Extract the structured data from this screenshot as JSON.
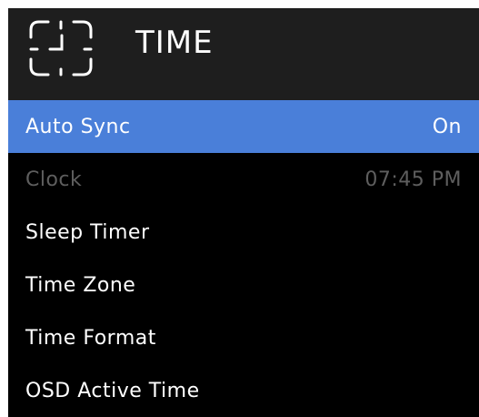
{
  "header": {
    "title": "TIME",
    "icon": "clock-icon"
  },
  "menu": {
    "items": [
      {
        "label": "Auto Sync",
        "value": "On",
        "state": "selected"
      },
      {
        "label": "Clock",
        "value": "07:45 PM",
        "state": "disabled"
      },
      {
        "label": "Sleep Timer",
        "value": "",
        "state": "normal"
      },
      {
        "label": "Time Zone",
        "value": "",
        "state": "normal"
      },
      {
        "label": "Time Format",
        "value": "",
        "state": "normal"
      },
      {
        "label": "OSD Active Time",
        "value": "",
        "state": "normal"
      }
    ]
  },
  "colors": {
    "panel_background": "#000000",
    "header_background": "#1e1e1e",
    "selected_background": "#4a7fd9",
    "text": "#ffffff",
    "disabled_text": "#5e5e5e"
  }
}
